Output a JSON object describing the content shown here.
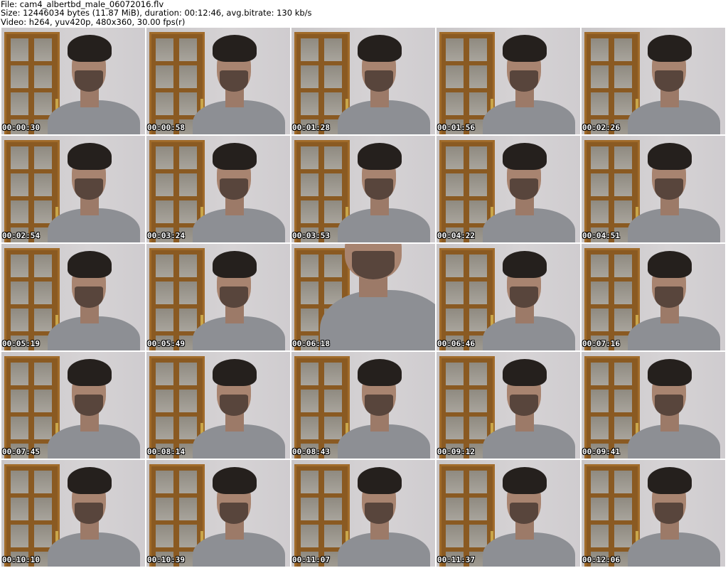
{
  "header": {
    "file_line": "File: cam4_albertbd_male_06072016.flv",
    "size_line": "Size: 12446034 bytes (11.87 MiB), duration: 00:12:46, avg.bitrate: 130 kb/s",
    "video_line": "Video: h264, yuv420p, 480x360, 30.00 fps(r)"
  },
  "thumbnails": [
    {
      "time": "00:00:30"
    },
    {
      "time": "00:00:58"
    },
    {
      "time": "00:01:28"
    },
    {
      "time": "00:01:56"
    },
    {
      "time": "00:02:26"
    },
    {
      "time": "00:02:54"
    },
    {
      "time": "00:03:24"
    },
    {
      "time": "00:03:53"
    },
    {
      "time": "00:04:22"
    },
    {
      "time": "00:04:51"
    },
    {
      "time": "00:05:19"
    },
    {
      "time": "00:05:49"
    },
    {
      "time": "00:06:18",
      "variant": "close"
    },
    {
      "time": "00:06:46"
    },
    {
      "time": "00:07:16"
    },
    {
      "time": "00:07:45"
    },
    {
      "time": "00:08:14"
    },
    {
      "time": "00:08:43"
    },
    {
      "time": "00:09:12"
    },
    {
      "time": "00:09:41"
    },
    {
      "time": "00:10:10"
    },
    {
      "time": "00:10:39"
    },
    {
      "time": "00:11:07"
    },
    {
      "time": "00:11:37"
    },
    {
      "time": "00:12:06"
    }
  ]
}
